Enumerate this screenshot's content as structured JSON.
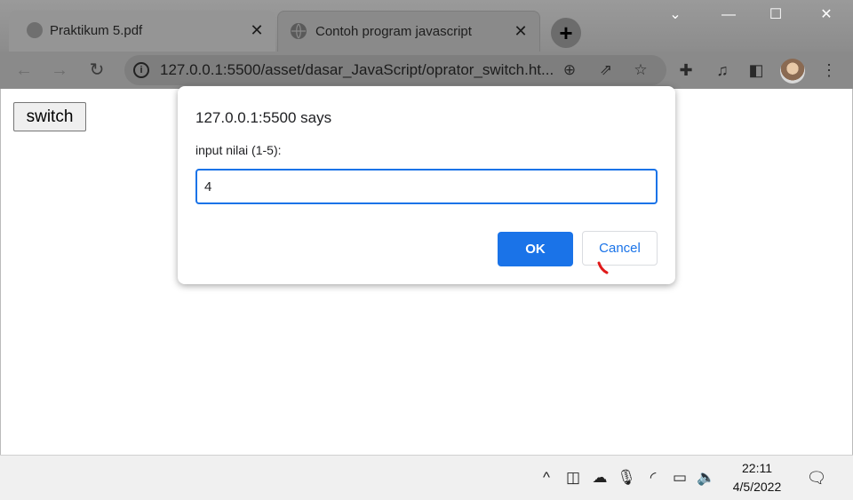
{
  "browser": {
    "tabs": [
      {
        "title": "Praktikum 5.pdf",
        "active": false
      },
      {
        "title": "Contoh program javascript",
        "active": true
      }
    ],
    "address_bar": {
      "url": "127.0.0.1:5500/asset/dasar_JavaScript/oprator_switch.ht..."
    }
  },
  "page": {
    "switch_button_label": "switch"
  },
  "dialog": {
    "title": "127.0.0.1:5500 says",
    "message": "input nilai (1-5):",
    "input_value": "4",
    "ok_label": "OK",
    "cancel_label": "Cancel",
    "accent_color": "#1a73e8"
  },
  "taskbar": {
    "time": "22:11",
    "date": "4/5/2022"
  },
  "icons": {
    "back": "arrow-left-icon",
    "forward": "arrow-right-icon",
    "reload": "reload-icon",
    "site_info": "info-icon",
    "zoom": "magnifier-plus-icon",
    "share": "share-icon",
    "bookmark": "star-icon",
    "extensions": "puzzle-icon",
    "media": "media-playlist-icon",
    "side_panel": "side-panel-icon",
    "menu": "kebab-menu-icon"
  }
}
